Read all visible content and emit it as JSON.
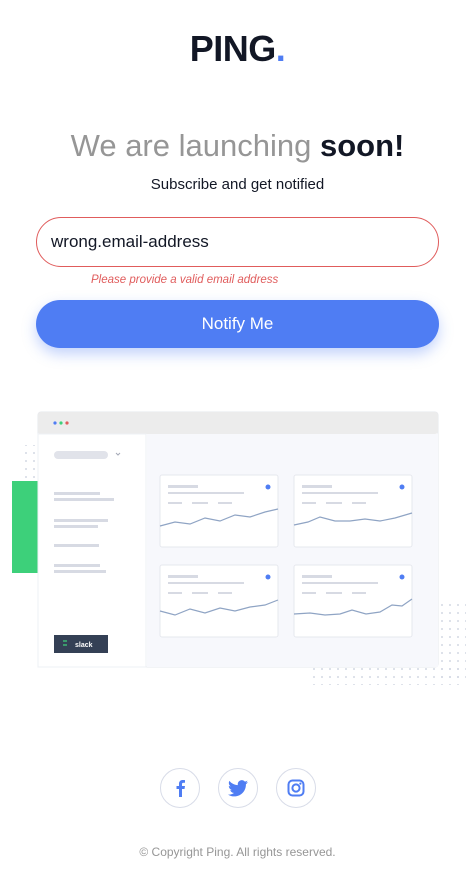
{
  "logo": {
    "text": "PING",
    "dot": "."
  },
  "headline": {
    "lead": "We are launching",
    "emphasis": "soon!"
  },
  "subhead": "Subscribe and get notified",
  "form": {
    "email_value": "wrong.email-address",
    "error": "Please provide a valid email address",
    "submit_label": "Notify Me"
  },
  "illustration": {
    "badge_label": "slack"
  },
  "social": {
    "items": [
      {
        "name": "facebook",
        "icon": "facebook-icon"
      },
      {
        "name": "twitter",
        "icon": "twitter-icon"
      },
      {
        "name": "instagram",
        "icon": "instagram-icon"
      }
    ]
  },
  "footer": "© Copyright Ping. All rights reserved.",
  "colors": {
    "accent": "#4f7df3",
    "error": "#e05c5c",
    "dark": "#121725",
    "muted": "#969696",
    "green_block": "#3dd07a"
  }
}
